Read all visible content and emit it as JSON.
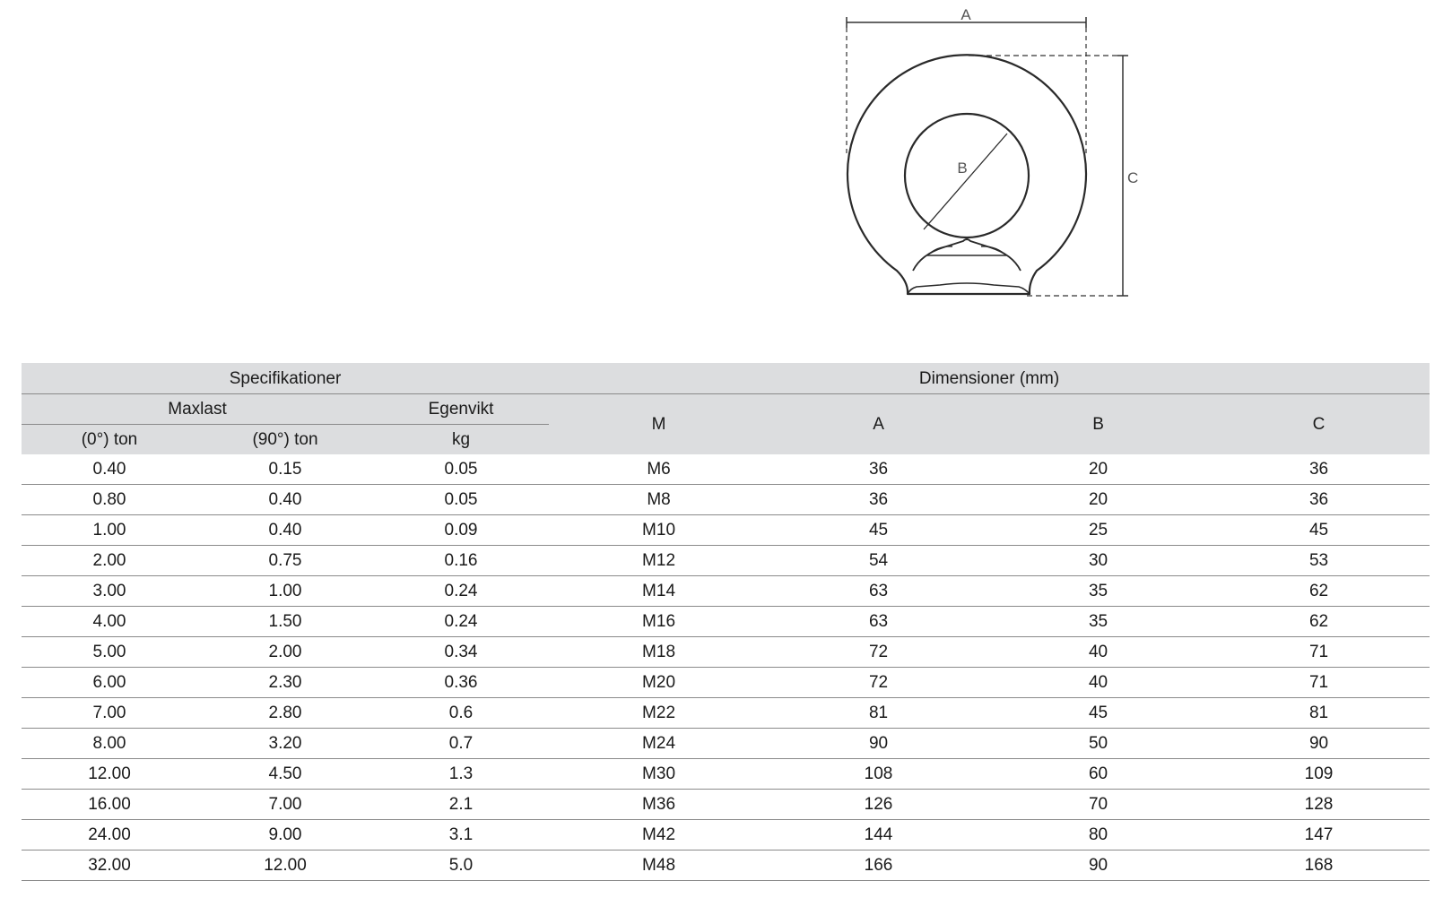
{
  "drawing": {
    "dimension_labels": {
      "a": "A",
      "b": "B",
      "c": "C"
    }
  },
  "table": {
    "group_headers": {
      "specs": "Specifikationer",
      "dimensions": "Dimensioner (mm)"
    },
    "sub_headers": {
      "maxlast": "Maxlast",
      "egenvikt": "Egenvikt",
      "m": "M",
      "a": "A",
      "b": "B",
      "c": "C"
    },
    "unit_headers": {
      "load_0": "(0°) ton",
      "load_90": "(90°) ton",
      "weight": "kg"
    },
    "rows": [
      [
        "0.40",
        "0.15",
        "0.05",
        "M6",
        "36",
        "20",
        "36"
      ],
      [
        "0.80",
        "0.40",
        "0.05",
        "M8",
        "36",
        "20",
        "36"
      ],
      [
        "1.00",
        "0.40",
        "0.09",
        "M10",
        "45",
        "25",
        "45"
      ],
      [
        "2.00",
        "0.75",
        "0.16",
        "M12",
        "54",
        "30",
        "53"
      ],
      [
        "3.00",
        "1.00",
        "0.24",
        "M14",
        "63",
        "35",
        "62"
      ],
      [
        "4.00",
        "1.50",
        "0.24",
        "M16",
        "63",
        "35",
        "62"
      ],
      [
        "5.00",
        "2.00",
        "0.34",
        "M18",
        "72",
        "40",
        "71"
      ],
      [
        "6.00",
        "2.30",
        "0.36",
        "M20",
        "72",
        "40",
        "71"
      ],
      [
        "7.00",
        "2.80",
        "0.6",
        "M22",
        "81",
        "45",
        "81"
      ],
      [
        "8.00",
        "3.20",
        "0.7",
        "M24",
        "90",
        "50",
        "90"
      ],
      [
        "12.00",
        "4.50",
        "1.3",
        "M30",
        "108",
        "60",
        "109"
      ],
      [
        "16.00",
        "7.00",
        "2.1",
        "M36",
        "126",
        "70",
        "128"
      ],
      [
        "24.00",
        "9.00",
        "3.1",
        "M42",
        "144",
        "80",
        "147"
      ],
      [
        "32.00",
        "12.00",
        "5.0",
        "M48",
        "166",
        "90",
        "168"
      ]
    ]
  }
}
